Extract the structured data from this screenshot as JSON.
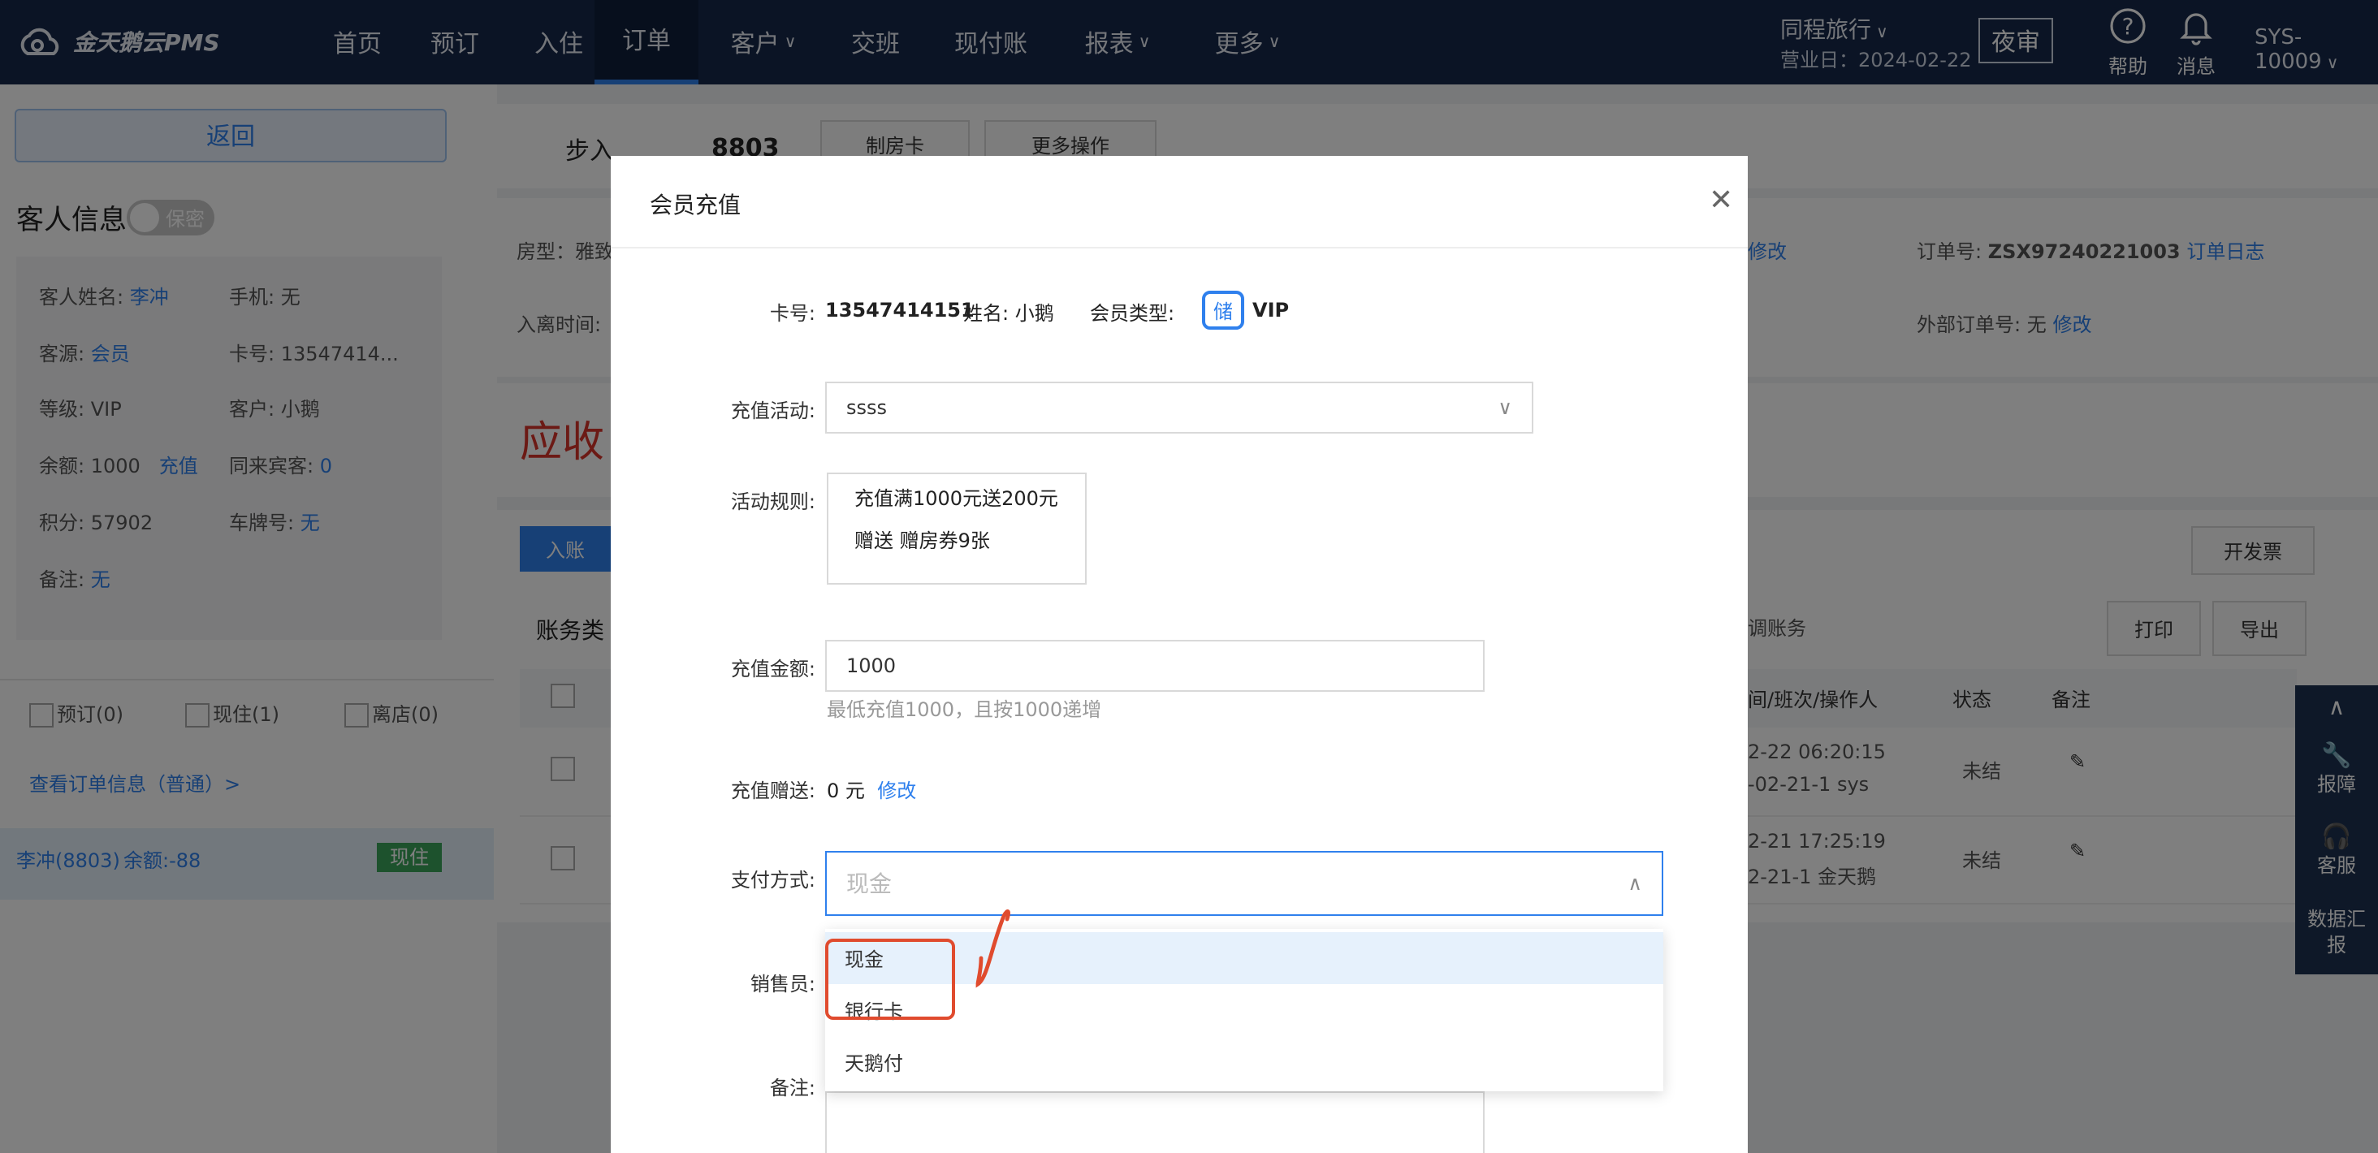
{
  "topbar": {
    "logo_text": "金天鹅云PMS",
    "nav": [
      "首页",
      "预订",
      "入住",
      "订单",
      "客户",
      "交班",
      "现付账",
      "报表",
      "更多"
    ],
    "hotel": "同程旅行",
    "business_day": "营业日：2024-02-22",
    "night_audit": "夜审",
    "help": "帮助",
    "messages": "消息",
    "user": "SYS-10009"
  },
  "left": {
    "back": "返回",
    "section_title": "客人信息",
    "privacy_toggle": "保密",
    "guest_name_label": "客人姓名:",
    "guest_name": "李冲",
    "phone_label": "手机:",
    "phone": "无",
    "source_label": "客源:",
    "source": "会员",
    "card_label": "卡号:",
    "card": "13547414...",
    "level_label": "等级:",
    "level": "VIP",
    "customer_label": "客户:",
    "customer": "小鹅",
    "balance_label": "余额:",
    "balance": "1000",
    "recharge_link": "充值",
    "companions_label": "同来宾客:",
    "companions": "0",
    "points_label": "积分:",
    "points": "57902",
    "plate_label": "车牌号:",
    "plate": "无",
    "remark_label": "备注:",
    "remark": "无",
    "filter_reserved": "预订(0)",
    "filter_inhouse": "现住(1)",
    "filter_departed": "离店(0)",
    "view_order": "查看订单信息（普通）>",
    "guest_entry": "李冲(8803)",
    "guest_balance": "余额:-88",
    "guest_status": "现住"
  },
  "right": {
    "checkin_type": "步入",
    "room_no": "8803",
    "make_card": "制房卡",
    "more_ops": "更多操作",
    "room_type_label": "房型：雅致",
    "stay_time_label": "入离时间:",
    "modify": "修改",
    "order_no_label": "订单号:",
    "order_no": "ZSX97240221003",
    "order_log": "订单日志",
    "external_order_label": "外部订单号:",
    "external_order": "无",
    "external_modify": "修改",
    "receivable": "应收",
    "post_button": "入账",
    "invoice": "开发票",
    "account_type": "账务类",
    "adjust": "调账务",
    "print": "打印",
    "export": "导出",
    "col_operator": "间/班次/操作人",
    "col_status": "状态",
    "col_note": "备注",
    "rows": [
      {
        "time": "2-22 06:20:15",
        "shift": "-02-21-1 sys",
        "status": "未结"
      },
      {
        "time": "2-21 17:25:19",
        "shift": "2-21-1 金天鹅",
        "status": "未结"
      }
    ]
  },
  "sidetool": {
    "report_issue": "报障",
    "service": "客服",
    "data_report": "数据汇报"
  },
  "modal": {
    "title": "会员充值",
    "card_label": "卡号:",
    "card_no": "13547414151",
    "name_label": "姓名:",
    "name": "小鹅",
    "member_type_label": "会员类型:",
    "stored_tag": "储",
    "member_type": "VIP",
    "activity_label": "充值活动:",
    "activity": "ssss",
    "rules_label": "活动规则:",
    "rule1": "充值满1000元送200元",
    "rule2": "赠送 赠房券9张",
    "amount_label": "充值金额:",
    "amount": "1000",
    "amount_hint": "最低充值1000，且按1000递增",
    "bonus_label": "充值赠送:",
    "bonus": "0 元",
    "bonus_modify": "修改",
    "payment_label": "支付方式:",
    "payment_placeholder": "现金",
    "salesperson_label": "销售员:",
    "remark_label": "备注:",
    "payment_options": [
      "现金",
      "银行卡",
      "天鹅付"
    ]
  },
  "colors": {
    "topbar": "#17294b",
    "accent": "#2f80ed",
    "danger": "#d9352b",
    "annotation": "#e04b2e"
  }
}
